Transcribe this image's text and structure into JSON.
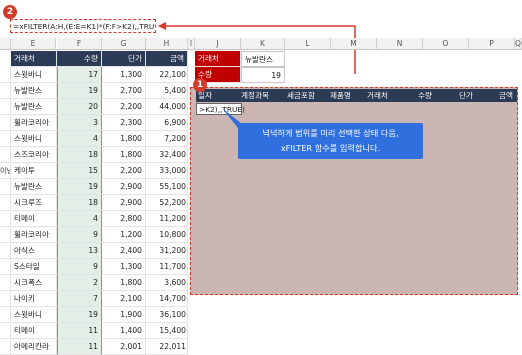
{
  "formula_bar": {
    "text": "=xFILTER(A:H,(E:E=K1)*(F:F>K2),,TRUE)"
  },
  "callout_badges": {
    "one": "1",
    "two": "2"
  },
  "columns": [
    "E",
    "F",
    "G",
    "H",
    "I",
    "J",
    "K",
    "L",
    "M",
    "N",
    "O",
    "P",
    "Q"
  ],
  "left_table": {
    "headers": [
      "거래처",
      "수량",
      "단가",
      "금액"
    ],
    "rows": [
      [
        "스윗바니",
        "17",
        "1,300",
        "22,100"
      ],
      [
        "뉴발란스",
        "19",
        "2,700",
        "5,400"
      ],
      [
        "뉴발란스",
        "20",
        "2,200",
        "44,000"
      ],
      [
        "휠라코리아",
        "3",
        "2,300",
        "6,900"
      ],
      [
        "스윗바니",
        "4",
        "1,800",
        "7,200"
      ],
      [
        "스즈코리아",
        "18",
        "1,800",
        "32,400"
      ],
      [
        "케이투",
        "15",
        "2,200",
        "33,000"
      ],
      [
        "뉴발란스",
        "19",
        "2,900",
        "55,100"
      ],
      [
        "시크루즈",
        "18",
        "2,900",
        "52,200"
      ],
      [
        "티메이",
        "4",
        "2,800",
        "11,200"
      ],
      [
        "휠라코리아",
        "9",
        "1,200",
        "10,800"
      ],
      [
        "아식스",
        "13",
        "2,400",
        "31,200"
      ],
      [
        "S스타일",
        "9",
        "1,300",
        "11,700"
      ],
      [
        "시크폭스",
        "2",
        "1,800",
        "3,600"
      ],
      [
        "나이키",
        "7",
        "2,100",
        "14,700"
      ],
      [
        "스윗바니",
        "19",
        "1,900",
        "36,100"
      ],
      [
        "티메이",
        "11",
        "1,400",
        "15,400"
      ],
      [
        "아메리칸라",
        "11",
        "2,001",
        "22,011"
      ]
    ],
    "d_prefixes": [
      "",
      "",
      "",
      "",
      "",
      "",
      "이닝부",
      "",
      "",
      "",
      "",
      "",
      "",
      "",
      "",
      "",
      "",
      ""
    ]
  },
  "criteria": {
    "label1": "거래처",
    "value1": "뉴발란스",
    "label2": "수량",
    "value2": "19"
  },
  "output_headers": [
    "일자",
    "계정과목",
    "세금포함",
    "제품명",
    "거래처",
    "수량",
    "단가",
    "금액"
  ],
  "cell_entry": ">K2),,TRUE)",
  "callout_text": [
    "넉넉하게 범위를 미리 선택한 상태 다음,",
    "xFILTER 함수를 입력합니다."
  ],
  "colors": {
    "header_dark": "#2b3a55",
    "criteria_red": "#c00000",
    "selection": "#cbb6b4",
    "accent_red": "#d43a2a",
    "callout_blue": "#2f6fde"
  }
}
